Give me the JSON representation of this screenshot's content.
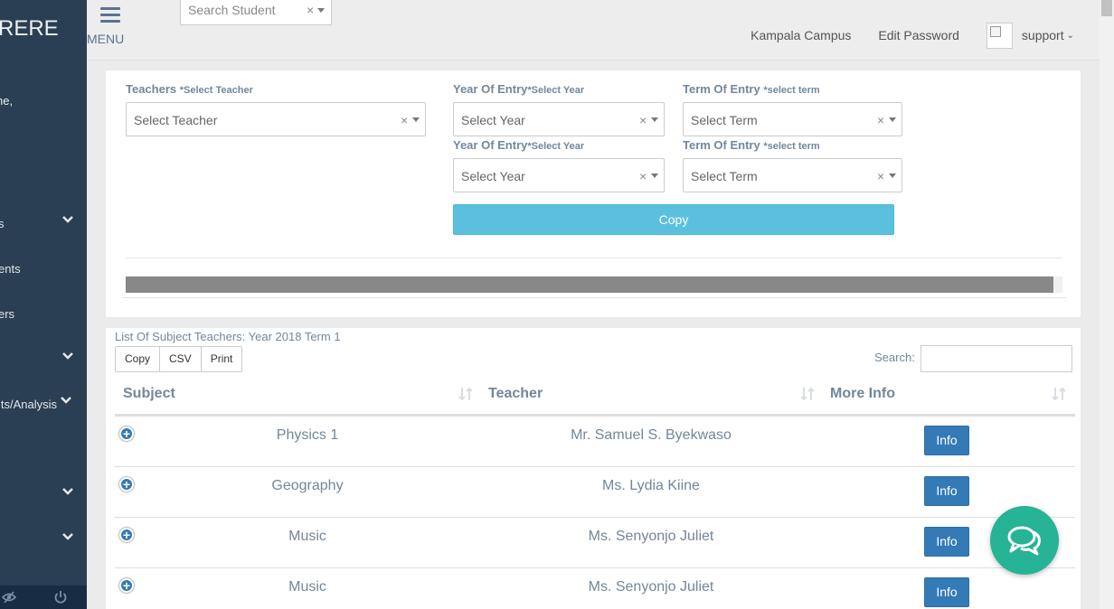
{
  "sidebar": {
    "brand": "RERE",
    "welcome": "ne,",
    "items": [
      {
        "label": "s",
        "chevron": true
      },
      {
        "label": "ents",
        "chevron": false
      },
      {
        "label": "ers",
        "chevron": false
      },
      {
        "label": "",
        "chevron": true
      },
      {
        "label": "lts/Analysis",
        "chevron": true
      },
      {
        "label": "",
        "chevron": true
      },
      {
        "label": "",
        "chevron": true
      }
    ]
  },
  "topnav": {
    "menu_label": "MENU",
    "search_placeholder": "Search Student",
    "clear_symbol": "×",
    "campus": "Kampala Campus",
    "edit_password": "Edit Password",
    "user": "support"
  },
  "form": {
    "teachers_label": "Teachers ",
    "teachers_req": "*Select Teacher",
    "teacher_placeholder": "Select Teacher",
    "year_label": "Year Of Entry",
    "year_req": "*Select Year",
    "year_placeholder": "Select Year",
    "term_label": "Term Of Entry ",
    "term_req": "*select term",
    "term_placeholder": "Select Term",
    "copy_label": "Copy",
    "progress": 0.99
  },
  "list": {
    "title": "List Of Subject Teachers:  Year  2018  Term 1",
    "buttons": [
      "Copy",
      "CSV",
      "Print"
    ],
    "search_label": "Search:",
    "columns": [
      "Subject",
      "Teacher",
      "More Info"
    ],
    "rows": [
      {
        "subject": "Physics 1",
        "teacher": "Mr. Samuel S. Byekwaso",
        "action": "Info"
      },
      {
        "subject": "Geography",
        "teacher": "Ms. Lydia Kiine",
        "action": "Info"
      },
      {
        "subject": "Music",
        "teacher": "Ms. Senyonjo Juliet",
        "action": "Info"
      },
      {
        "subject": "Music",
        "teacher": "Ms. Senyonjo Juliet",
        "action": "Info"
      }
    ]
  },
  "colors": {
    "sidebar": "#2a3f54",
    "copy_button": "#5bc0de",
    "info_button": "#337ab7",
    "chat_fab": "#26b396"
  }
}
